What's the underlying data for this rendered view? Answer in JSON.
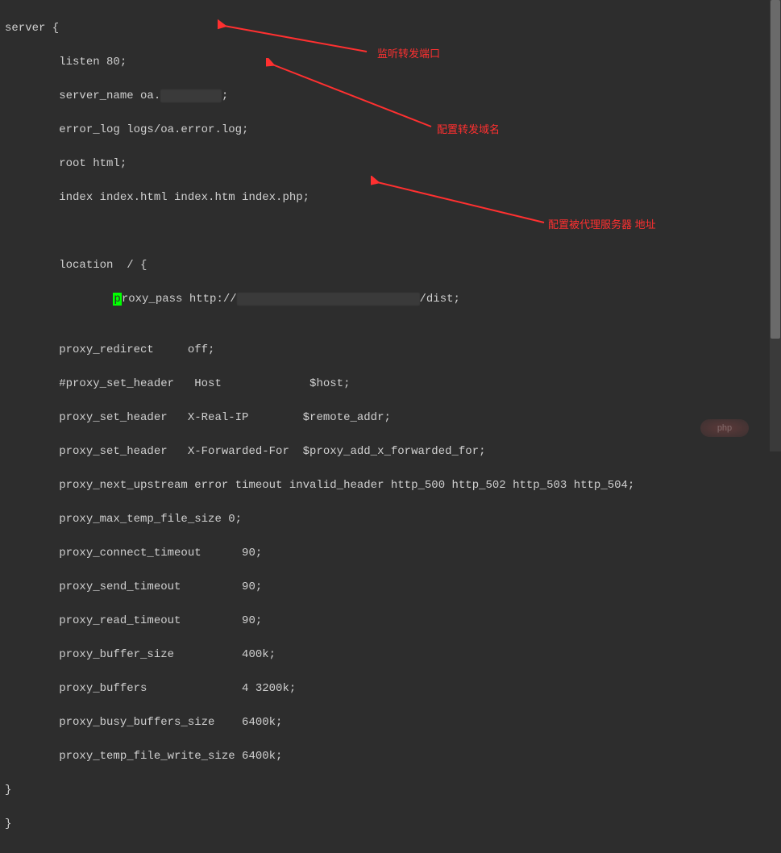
{
  "config": {
    "l1": "server {",
    "l2": "        listen 80;",
    "l3_a": "        server_name oa.",
    "l3_b": "xxxxxxxxx",
    "l3_c": ";",
    "l4": "        error_log logs/oa.error.log;",
    "l5": "        root html;",
    "l6": "        index index.html index.htm index.php;",
    "l7": "",
    "l8": "",
    "l9": "        location  / {",
    "l10_a": "                ",
    "l10_cur": "p",
    "l10_b": "roxy_pass http://",
    "l10_sm": "xxxxxxxxxxxxxxxxxxxxxxxxxxx",
    "l10_c": "/dist;",
    "l11": "",
    "l12": "        proxy_redirect     off;",
    "l13": "        #proxy_set_header   Host             $host;",
    "l14": "        proxy_set_header   X-Real-IP        $remote_addr;",
    "l15": "        proxy_set_header   X-Forwarded-For  $proxy_add_x_forwarded_for;",
    "l16": "        proxy_next_upstream error timeout invalid_header http_500 http_502 http_503 http_504;",
    "l17": "        proxy_max_temp_file_size 0;",
    "l18": "        proxy_connect_timeout      90;",
    "l19": "        proxy_send_timeout         90;",
    "l20": "        proxy_read_timeout         90;",
    "l21": "        proxy_buffer_size          400k;",
    "l22": "        proxy_buffers              4 3200k;",
    "l23": "        proxy_busy_buffers_size    6400k;",
    "l24": "        proxy_temp_file_write_size 6400k;",
    "l25": "}",
    "l26": "}"
  },
  "annotations": {
    "a1": "监听转发端口",
    "a2": "配置转发域名",
    "a3": "配置被代理服务器 地址"
  },
  "watermark": "php",
  "colors": {
    "bg": "#2d2d2d",
    "text": "#d0d0d0",
    "cursor_bg": "#00ff00",
    "annotation": "#ff3030"
  }
}
